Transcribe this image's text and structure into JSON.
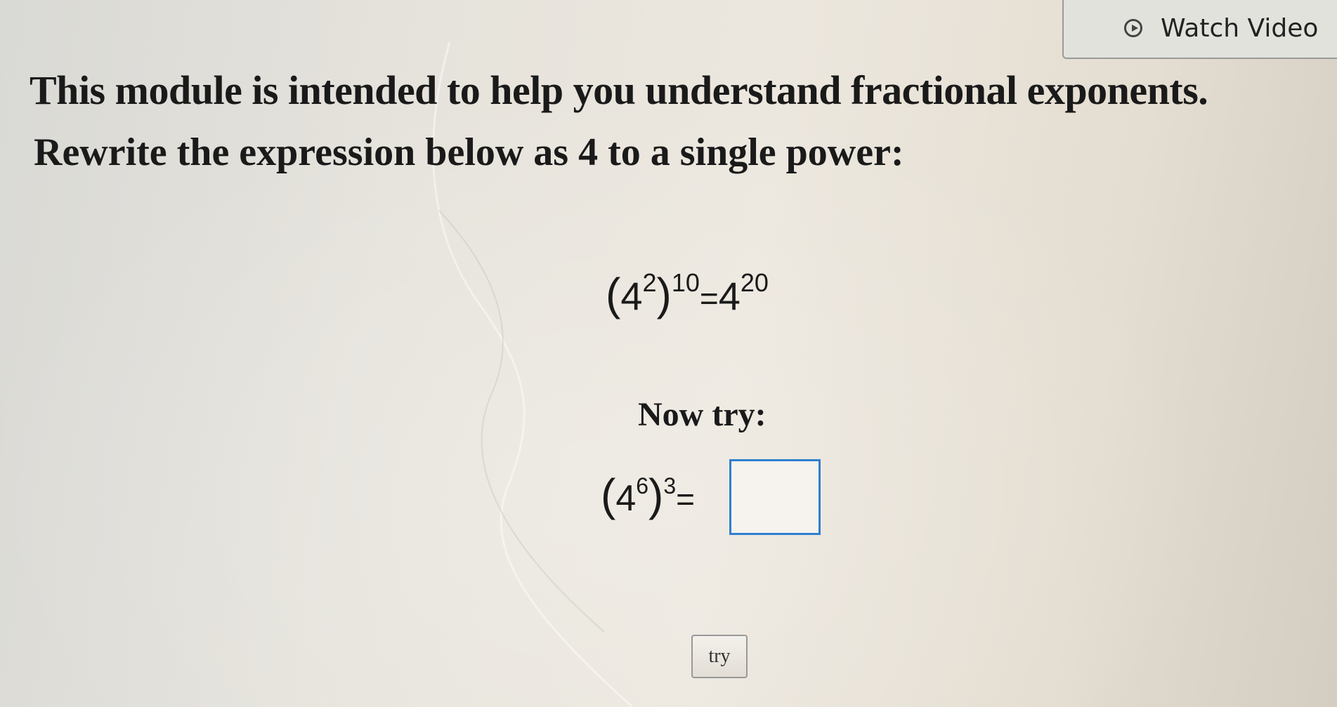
{
  "header": {
    "watch_video_label": "Watch Video"
  },
  "instructions": {
    "intro": "This module is intended to help you understand fractional exponents.",
    "prompt": "Rewrite the expression below as 4 to a single power:"
  },
  "example": {
    "base": "4",
    "inner_exponent": "2",
    "outer_exponent": "10",
    "result_base": "4",
    "result_exponent": "20"
  },
  "practice": {
    "heading": "Now try:",
    "base": "4",
    "inner_exponent": "6",
    "outer_exponent": "3",
    "answer_value": ""
  },
  "actions": {
    "try_label": "try"
  }
}
